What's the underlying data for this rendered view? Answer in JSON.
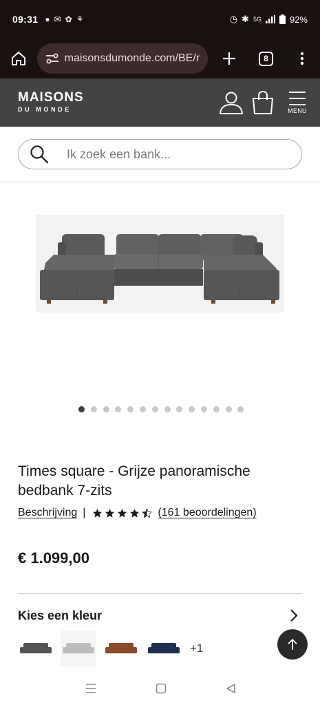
{
  "status_bar": {
    "time": "09:31",
    "battery": "92%",
    "network": "5G"
  },
  "browser": {
    "url": "maisonsdumonde.com/BE/nl/p",
    "tab_count": "8"
  },
  "header": {
    "logo_top": "MAISONS",
    "logo_bottom": "DU MONDE",
    "menu_label": "MENU"
  },
  "search": {
    "placeholder": "Ik zoek een bank..."
  },
  "gallery": {
    "image_count": 14,
    "active_index": 0
  },
  "product": {
    "title": "Times square - Grijze panoramische bedbank 7-zits",
    "description_link": "Beschrijving",
    "separator": "|",
    "rating": 4.5,
    "rating_max": 5,
    "reviews_link": "(161 beoordelingen)",
    "price": "€ 1.099,00"
  },
  "colors": {
    "title": "Kies een kleur",
    "swatches": [
      {
        "name": "dark-grey",
        "color": "#555555"
      },
      {
        "name": "light-grey",
        "color": "#bcbcbc"
      },
      {
        "name": "cognac",
        "color": "#8a4a2c"
      },
      {
        "name": "navy",
        "color": "#1e2f52"
      }
    ],
    "more": "+1"
  },
  "theme": {
    "status_bg": "#1b1010",
    "header_bg": "#414441",
    "url_bg": "#3d2b2b"
  }
}
